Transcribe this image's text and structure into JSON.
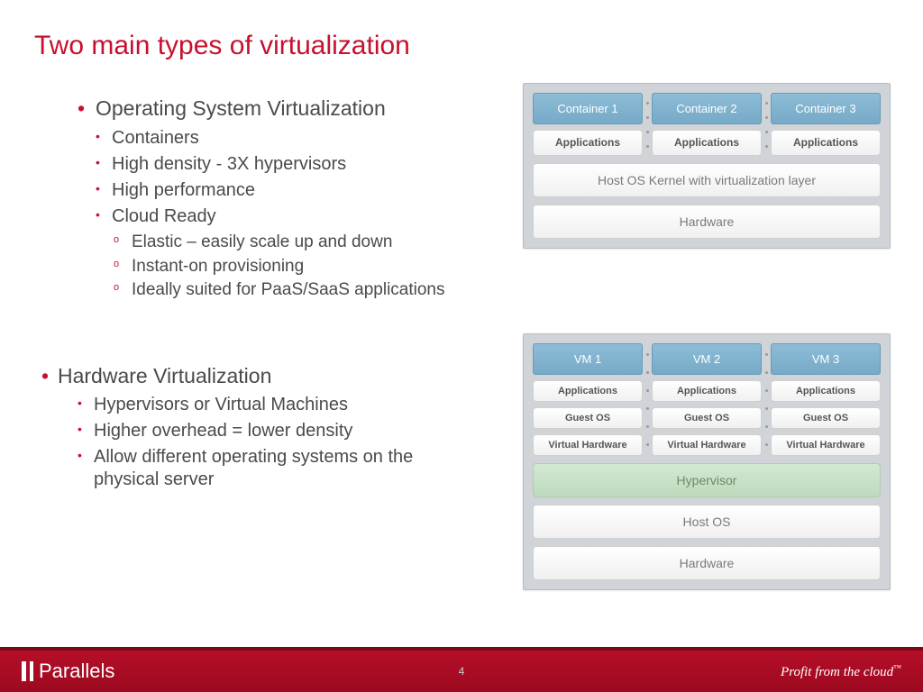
{
  "title": "Two main types of virtualization",
  "bullets": {
    "s1": {
      "heading": "Operating System Virtualization",
      "items": [
        "Containers",
        "High density - 3X hypervisors",
        "High performance",
        "Cloud Ready"
      ],
      "sub_cloud": [
        "Elastic – easily scale up and down",
        "Instant-on provisioning",
        "Ideally suited for PaaS/SaaS applications"
      ]
    },
    "s2": {
      "heading": "Hardware Virtualization",
      "items": [
        "Hypervisors or Virtual Machines",
        "Higher overhead = lower density",
        "Allow different operating systems on the physical server"
      ]
    }
  },
  "diagram1": {
    "cols": [
      "Container 1",
      "Container 2",
      "Container 3"
    ],
    "apps": "Applications",
    "kernel": "Host OS Kernel with virtualization layer",
    "hw": "Hardware"
  },
  "diagram2": {
    "cols": [
      "VM 1",
      "VM 2",
      "VM 3"
    ],
    "apps": "Applications",
    "guest": "Guest OS",
    "vhw": "Virtual Hardware",
    "hyper": "Hypervisor",
    "host": "Host OS",
    "hw": "Hardware"
  },
  "footer": {
    "brand": "Parallels",
    "page": "4",
    "tagline": "Profit from the cloud",
    "tm": "™"
  }
}
